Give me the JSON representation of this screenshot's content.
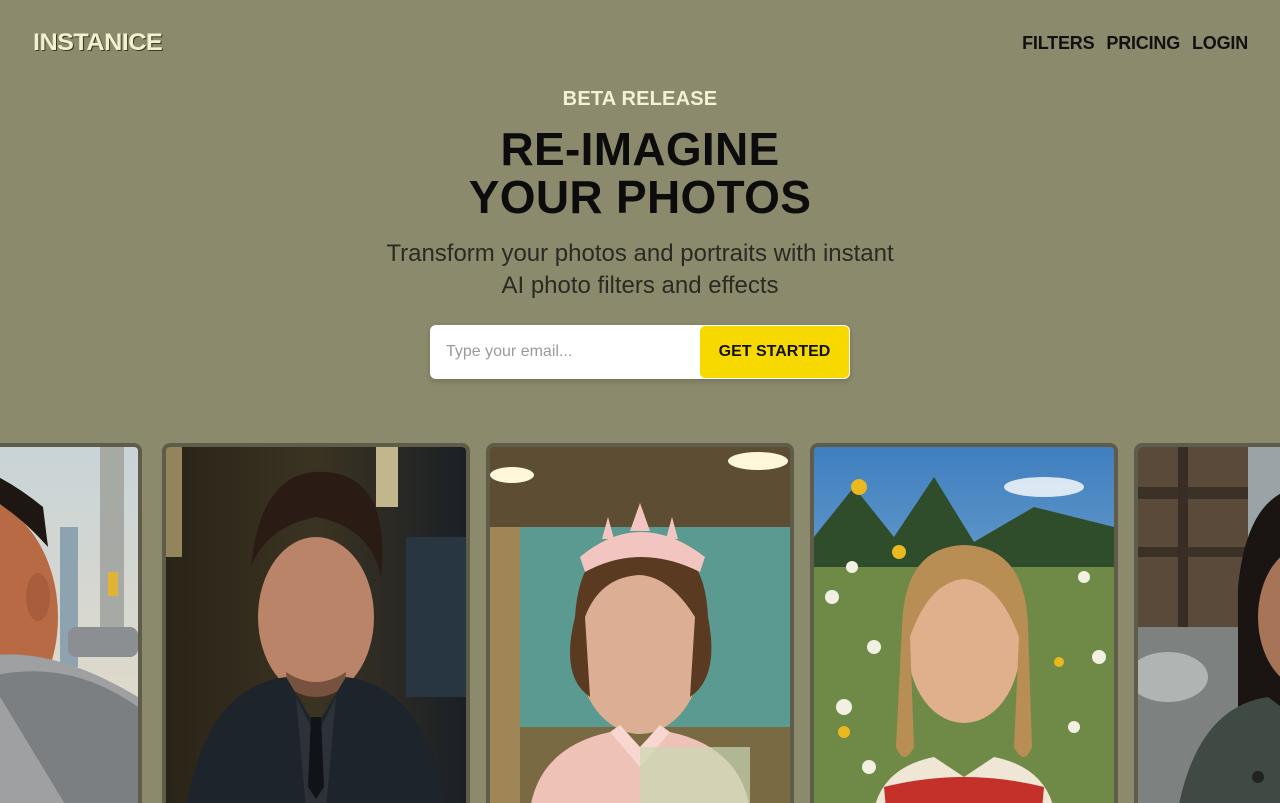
{
  "header": {
    "logo": "INSTANICE",
    "nav": [
      "FILTERS",
      "PRICING",
      "LOGIN"
    ]
  },
  "hero": {
    "eyebrow": "BETA RELEASE",
    "headline_line1": "RE-IMAGINE",
    "headline_line2": "YOUR PHOTOS",
    "subtitle": "Transform your photos and portraits with instant AI photo filters and effects"
  },
  "signup": {
    "placeholder": "Type your email...",
    "button": "GET STARTED"
  },
  "gallery": {
    "cards": [
      {
        "name": "portrait-man-city"
      },
      {
        "name": "portrait-man-dark-suit"
      },
      {
        "name": "portrait-woman-crown"
      },
      {
        "name": "portrait-girl-meadow"
      },
      {
        "name": "portrait-woman-street"
      }
    ]
  },
  "colors": {
    "background": "#8c8a6c",
    "accent": "#f7d900",
    "card_border": "#5f5d4a"
  }
}
